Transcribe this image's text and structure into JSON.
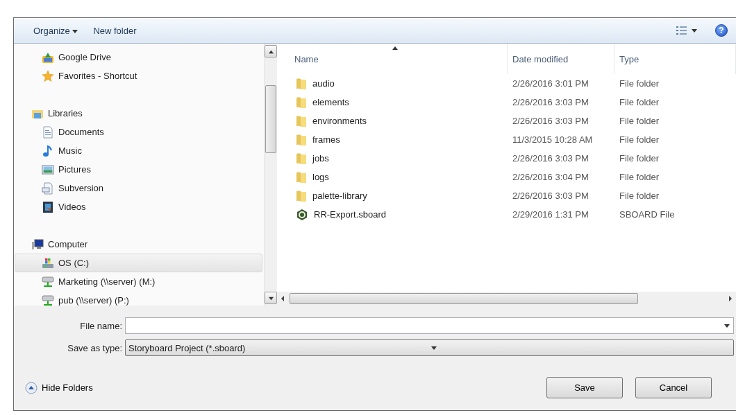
{
  "toolbar": {
    "buttons": [
      {
        "label": "Organize",
        "kind": "menu"
      },
      {
        "label": "New folder",
        "kind": "plain"
      }
    ],
    "help": "?"
  },
  "nav": {
    "sections": [
      {
        "items": [
          {
            "label": "Google Drive",
            "kind": "drive",
            "selected": false
          },
          {
            "label": "Favorites - Shortcut",
            "kind": "star",
            "selected": false
          }
        ]
      },
      {
        "label": "Libraries",
        "kind": "library",
        "items": [
          {
            "label": "Documents",
            "kind": "document",
            "selected": false
          },
          {
            "label": "Music",
            "kind": "music",
            "selected": false
          },
          {
            "label": "Pictures",
            "kind": "pictures",
            "selected": false
          },
          {
            "label": "Subversion",
            "kind": "subversion",
            "selected": false
          },
          {
            "label": "Videos",
            "kind": "videos",
            "selected": false
          }
        ]
      },
      {
        "label": "Computer",
        "kind": "computer",
        "items": [
          {
            "label": "OS (C:)",
            "kind": "disk",
            "selected": true
          },
          {
            "label": "Marketing (\\\\server) (M:)",
            "kind": "network",
            "selected": false
          },
          {
            "label": "pub (\\\\server) (P:)",
            "kind": "network",
            "selected": false
          }
        ]
      }
    ]
  },
  "table": {
    "columns": [
      {
        "label": "Name",
        "sorted": true
      },
      {
        "label": "Date modified",
        "sorted": false
      },
      {
        "label": "Type",
        "sorted": false
      }
    ],
    "rows": [
      {
        "name": "audio",
        "date": "2/26/2016 3:01 PM",
        "type": "File folder",
        "kind": "folder"
      },
      {
        "name": "elements",
        "date": "2/26/2016 3:03 PM",
        "type": "File folder",
        "kind": "folder"
      },
      {
        "name": "environments",
        "date": "2/26/2016 3:03 PM",
        "type": "File folder",
        "kind": "folder"
      },
      {
        "name": "frames",
        "date": "11/3/2015 10:28 AM",
        "type": "File folder",
        "kind": "folder"
      },
      {
        "name": "jobs",
        "date": "2/26/2016 3:03 PM",
        "type": "File folder",
        "kind": "folder"
      },
      {
        "name": "logs",
        "date": "2/26/2016 3:04 PM",
        "type": "File folder",
        "kind": "folder"
      },
      {
        "name": "palette-library",
        "date": "2/26/2016 3:03 PM",
        "type": "File folder",
        "kind": "folder"
      },
      {
        "name": "RR-Export.sboard",
        "date": "2/29/2016 1:31 PM",
        "type": "SBOARD File",
        "kind": "file"
      }
    ]
  },
  "form": {
    "file_name": {
      "label": "File name:"
    },
    "save_as_type": {
      "label": "Save as type:",
      "value": "Storyboard Project (*.sboard)"
    }
  },
  "footer": {
    "hide_folders": "Hide Folders",
    "buttons": [
      "Save",
      "Cancel"
    ]
  }
}
